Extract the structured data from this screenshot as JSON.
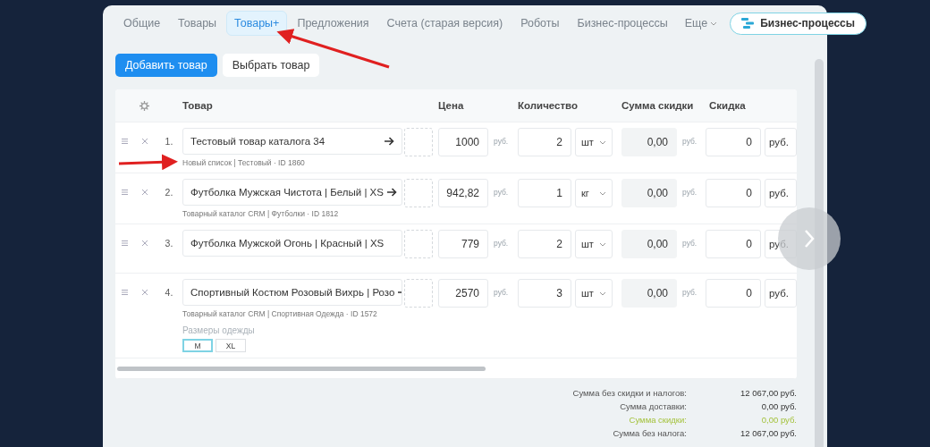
{
  "tabs": [
    {
      "label": "Общие",
      "selected": false
    },
    {
      "label": "Товары",
      "selected": false
    },
    {
      "label": "Товары+",
      "selected": true
    },
    {
      "label": "Предложения",
      "selected": false
    },
    {
      "label": "Счета (старая версия)",
      "selected": false
    },
    {
      "label": "Роботы",
      "selected": false
    },
    {
      "label": "Бизнес-процессы",
      "selected": false
    }
  ],
  "more_tab": {
    "label": "Еще"
  },
  "process_button": {
    "label": "Бизнес-процессы"
  },
  "actions": [
    {
      "label": "Добавить товар",
      "kind": "primary"
    },
    {
      "label": "Выбрать товар",
      "kind": "secondary"
    }
  ],
  "table": {
    "columns": [
      "Товар",
      "Цена",
      "Количество",
      "Сумма скидки",
      "Скидка"
    ],
    "rows": [
      {
        "number": "1.",
        "product": "Тестовый товар каталога 34",
        "source": "Новый список | Тестовый · ID 1860",
        "link": true,
        "price": "1000",
        "price_currency": "руб.",
        "quantity": "2",
        "unit": "шт",
        "discount_sum": "0,00",
        "discount_sum_currency": "руб.",
        "discount": "0",
        "discount_unit": "руб."
      },
      {
        "number": "2.",
        "product": "Футболка Мужская Чистота | Белый | XS",
        "source": "Товарный каталог CRM | Футболки · ID 1812",
        "link": true,
        "price": "942,82",
        "price_currency": "руб.",
        "quantity": "1",
        "unit": "кг",
        "discount_sum": "0,00",
        "discount_sum_currency": "руб.",
        "discount": "0",
        "discount_unit": "руб."
      },
      {
        "number": "3.",
        "product": "Футболка Мужской Огонь | Красный | XS",
        "link": false,
        "price": "779",
        "price_currency": "руб.",
        "quantity": "2",
        "unit": "шт",
        "discount_sum": "0,00",
        "discount_sum_currency": "руб.",
        "discount": "0",
        "discount_unit": "руб."
      },
      {
        "number": "4.",
        "product": "Спортивный Костюм Розовый Вихрь | Розо",
        "source": "Товарный каталог CRM | Спортивная Одежда · ID 1572",
        "link": true,
        "price": "2570",
        "price_currency": "руб.",
        "quantity": "3",
        "unit": "шт",
        "discount_sum": "0,00",
        "discount_sum_currency": "руб.",
        "discount": "0",
        "discount_unit": "руб.",
        "property": {
          "label": "Размеры одежды",
          "options": [
            {
              "label": "M",
              "selected": true
            },
            {
              "label": "XL",
              "selected": false
            }
          ]
        }
      }
    ]
  },
  "summary": [
    {
      "label": "Сумма без скидки и налогов:",
      "value": "12 067,00 руб.",
      "kind": "normal"
    },
    {
      "label": "Сумма доставки:",
      "value": "0,00 руб.",
      "kind": "normal"
    },
    {
      "label": "Сумма скидки:",
      "value": "0,00 руб.",
      "kind": "discount"
    },
    {
      "label": "Сумма без налога:",
      "value": "12 067,00 руб.",
      "kind": "normal"
    }
  ]
}
